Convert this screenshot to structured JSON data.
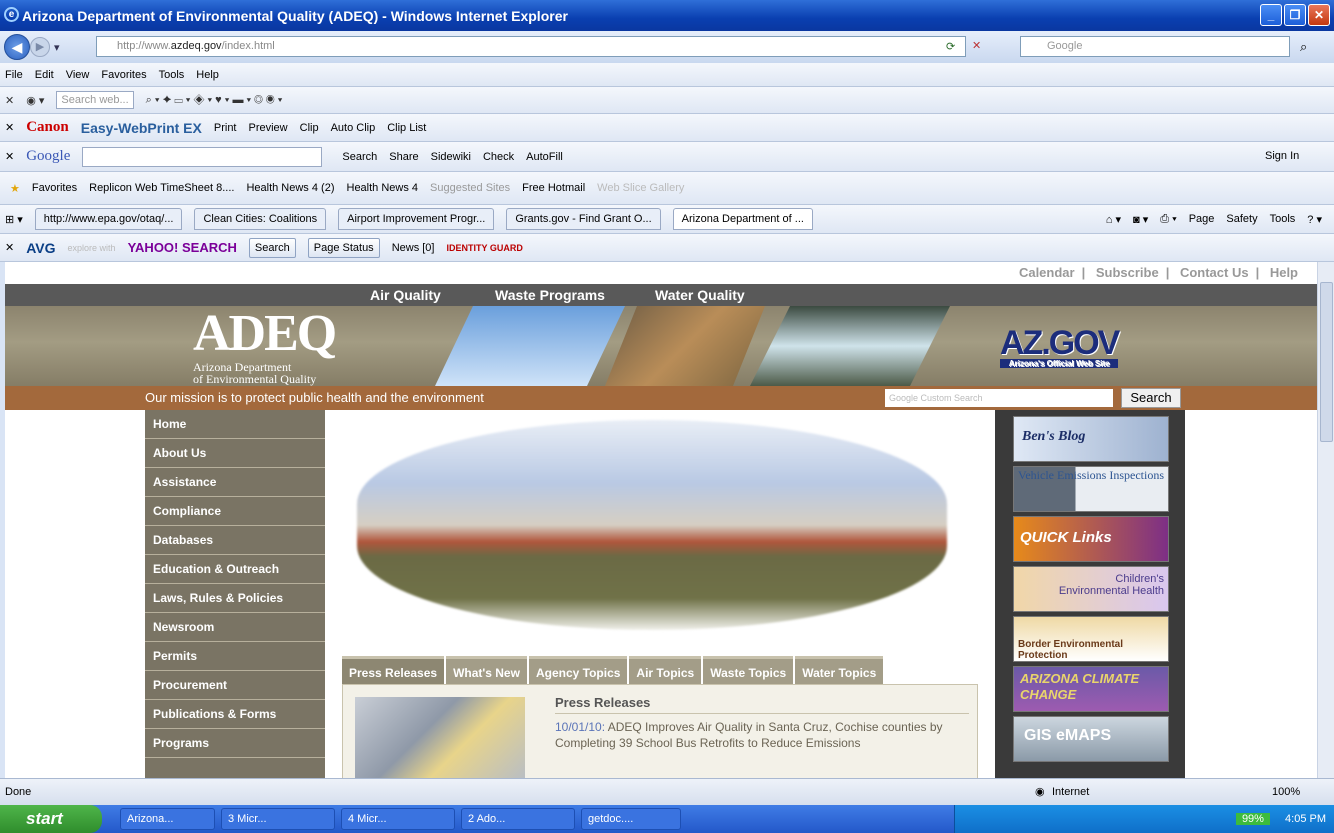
{
  "window": {
    "title": "Arizona Department of Environmental Quality (ADEQ) - Windows Internet Explorer"
  },
  "address": {
    "url_prefix": "http://www.",
    "url_domain": "azdeq.gov",
    "url_suffix": "/index.html",
    "search_placeholder": "Google"
  },
  "menu": [
    "File",
    "Edit",
    "View",
    "Favorites",
    "Tools",
    "Help"
  ],
  "toolbar2": {
    "search_placeholder": "Search web..."
  },
  "canon": {
    "brand": "Canon",
    "product": "Easy-WebPrint EX",
    "items": [
      "Print",
      "Preview",
      "Clip",
      "Auto Clip",
      "Clip List"
    ]
  },
  "google_bar": {
    "label": "Google",
    "items": [
      "Search",
      "Share",
      "Sidewiki",
      "Check",
      "AutoFill"
    ],
    "sign_in": "Sign In"
  },
  "favorites": {
    "label": "Favorites",
    "items": [
      "Replicon Web TimeSheet 8....",
      "Health News 4 (2)",
      "Health News 4",
      "Suggested Sites",
      "Free Hotmail",
      "Web Slice Gallery"
    ]
  },
  "tabs": [
    "http://www.epa.gov/otaq/...",
    "Clean Cities: Coalitions",
    "Airport Improvement Progr...",
    "Grants.gov - Find Grant O...",
    "Arizona Department of ..."
  ],
  "cmd_bar": [
    "Page",
    "Safety",
    "Tools"
  ],
  "avg_bar": {
    "brand": "AVG",
    "yahoo": "YAHOO! SEARCH",
    "search_placeholder": "explore with",
    "search_btn": "Search",
    "page_status": "Page Status",
    "news": "News [0]",
    "identity": "IDENTITY GUARD"
  },
  "site": {
    "util_links": [
      "Calendar",
      "Subscribe",
      "Contact Us",
      "Help"
    ],
    "top_nav": [
      "Air Quality",
      "Waste Programs",
      "Water Quality"
    ],
    "logo": {
      "big": "ADEQ",
      "line1": "Arizona Department",
      "line2": "of Environmental Quality"
    },
    "azgov": {
      "name": "AZ.GOV",
      "tagline": "Arizona's Official Web Site"
    },
    "mission": "Our mission is to protect public health and the environment",
    "custom_search_placeholder": "Google Custom Search",
    "search_btn": "Search",
    "left_nav": [
      "Home",
      "About Us",
      "Assistance",
      "Compliance",
      "Databases",
      "Education & Outreach",
      "Laws, Rules & Policies",
      "Newsroom",
      "Permits",
      "Procurement",
      "Publications & Forms",
      "Programs"
    ],
    "content_tabs": [
      "Press Releases",
      "What's New",
      "Agency Topics",
      "Air Topics",
      "Waste Topics",
      "Water Topics"
    ],
    "press": {
      "heading": "Press Releases",
      "date": "10/01/10:",
      "text": "ADEQ Improves Air Quality in Santa Cruz, Cochise counties by Completing 39 School Bus Retrofits to Reduce Emissions"
    },
    "promos": [
      "Ben's Blog",
      "Vehicle Emissions Inspections",
      "QUICK Links",
      "Children's Environmental Health",
      "Border Environmental Protection",
      "ARIZONA CLIMATE CHANGE",
      "GIS eMAPS"
    ]
  },
  "status": {
    "left": "Done",
    "zone": "Internet",
    "zoom": "100%"
  },
  "taskbar": {
    "start": "start",
    "tasks": [
      "Arizona...",
      "3 Micr...",
      "4 Micr...",
      "2 Ado...",
      "getdoc...."
    ],
    "battery": "99%",
    "time": "4:05 PM"
  }
}
